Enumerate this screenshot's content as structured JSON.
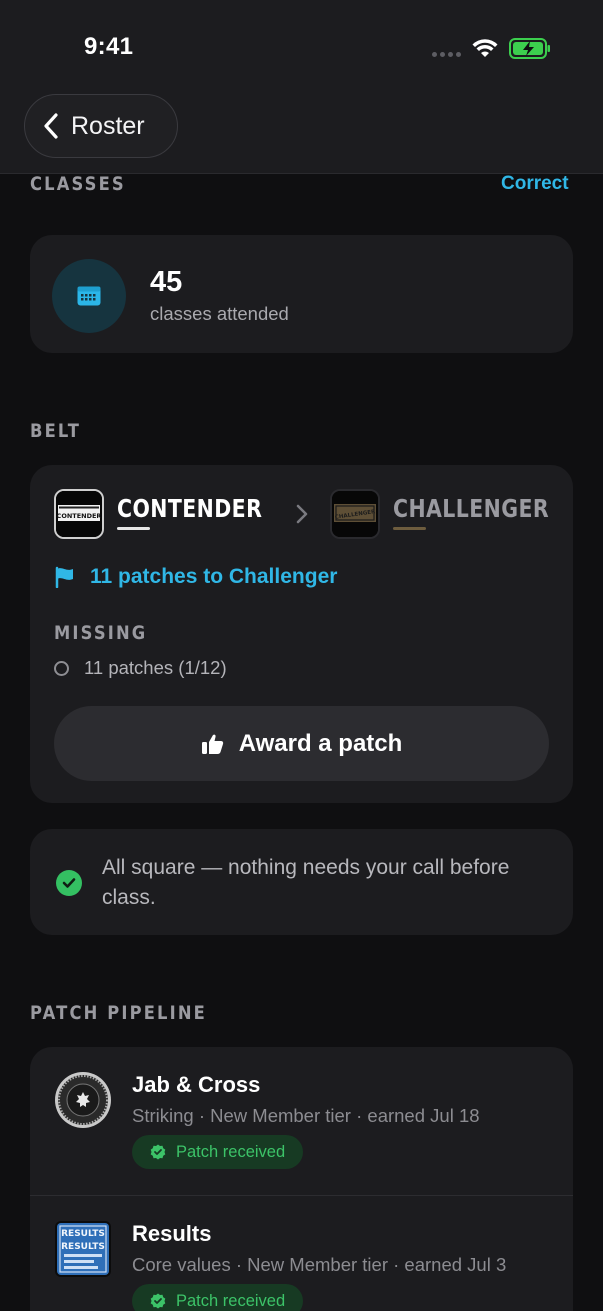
{
  "status_bar": {
    "time": "9:41"
  },
  "nav": {
    "back_label": "Roster"
  },
  "classes": {
    "section_label": "CLASSES",
    "action_label": "Correct",
    "count": "45",
    "caption": "classes attended",
    "icon": "calendar-icon"
  },
  "belt": {
    "section_label": "BELT",
    "current": {
      "name": "CONTENDER",
      "image_text": "CONTENDER",
      "underline_color": "#e6e6e6"
    },
    "next": {
      "name": "CHALLENGER",
      "image_text": "CHALLENGER",
      "underline_color": "#6d5c3e"
    },
    "progress_text": "11 patches to Challenger",
    "missing_label": "MISSING",
    "missing_items": [
      "11 patches (1/12)"
    ],
    "award_button_label": "Award a patch"
  },
  "status_message": "All square — nothing needs your call before class.",
  "pipeline": {
    "section_label": "PATCH PIPELINE",
    "items": [
      {
        "title": "Jab & Cross",
        "meta": "Striking · New Member tier · earned Jul 18",
        "badge": "Patch received",
        "icon": "round-patch-icon"
      },
      {
        "title": "Results",
        "meta": "Core values · New Member tier · earned Jul 3",
        "badge": "Patch received",
        "icon": "results-patch-icon",
        "image_text": "RESULTS"
      }
    ]
  },
  "colors": {
    "accent": "#30b7e6",
    "success": "#34c062",
    "background": "#0f0f11",
    "card": "#1c1c1f"
  }
}
